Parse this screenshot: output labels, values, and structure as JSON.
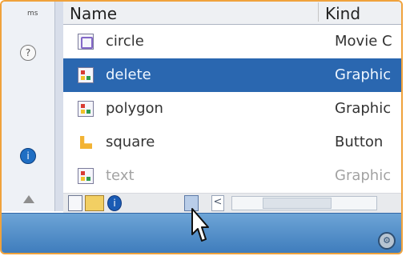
{
  "sidebar": {
    "top_text": "ms",
    "help_label": "?",
    "blue_label": "i"
  },
  "header": {
    "columns": [
      {
        "label": "Name"
      },
      {
        "label": "Kind"
      }
    ]
  },
  "library_items": [
    {
      "name": "circle",
      "kind": "Movie C",
      "icon": "movie-clip-icon",
      "selected": false
    },
    {
      "name": "delete",
      "kind": "Graphic",
      "icon": "graphic-icon",
      "selected": true
    },
    {
      "name": "polygon",
      "kind": "Graphic",
      "icon": "graphic-icon",
      "selected": false
    },
    {
      "name": "square",
      "kind": "Button",
      "icon": "button-icon",
      "selected": false
    },
    {
      "name": "text",
      "kind": "Graphic",
      "icon": "graphic-icon",
      "selected": false
    }
  ],
  "toolbar": {
    "properties_label": "i",
    "back_label": "<"
  },
  "colors": {
    "selection": "#2a67b0",
    "frame": "#f0a23c",
    "bottom_bar": "#3a79ba"
  }
}
